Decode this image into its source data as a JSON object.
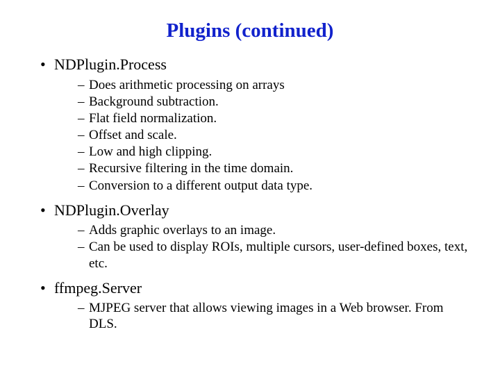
{
  "title": "Plugins (continued)",
  "sections": [
    {
      "heading": "NDPlugin.Process",
      "items": [
        "Does arithmetic processing on arrays",
        "Background subtraction.",
        "Flat field normalization.",
        "Offset and scale.",
        "Low and high clipping.",
        "Recursive filtering in the time domain.",
        "Conversion to a different output data type."
      ]
    },
    {
      "heading": "NDPlugin.Overlay",
      "items": [
        "Adds graphic overlays to an image.",
        "Can be used to display ROIs, multiple cursors, user-defined boxes, text, etc."
      ]
    },
    {
      "heading": "ffmpeg.Server",
      "items": [
        "MJPEG server that allows viewing images in a Web browser.  From DLS."
      ]
    }
  ]
}
